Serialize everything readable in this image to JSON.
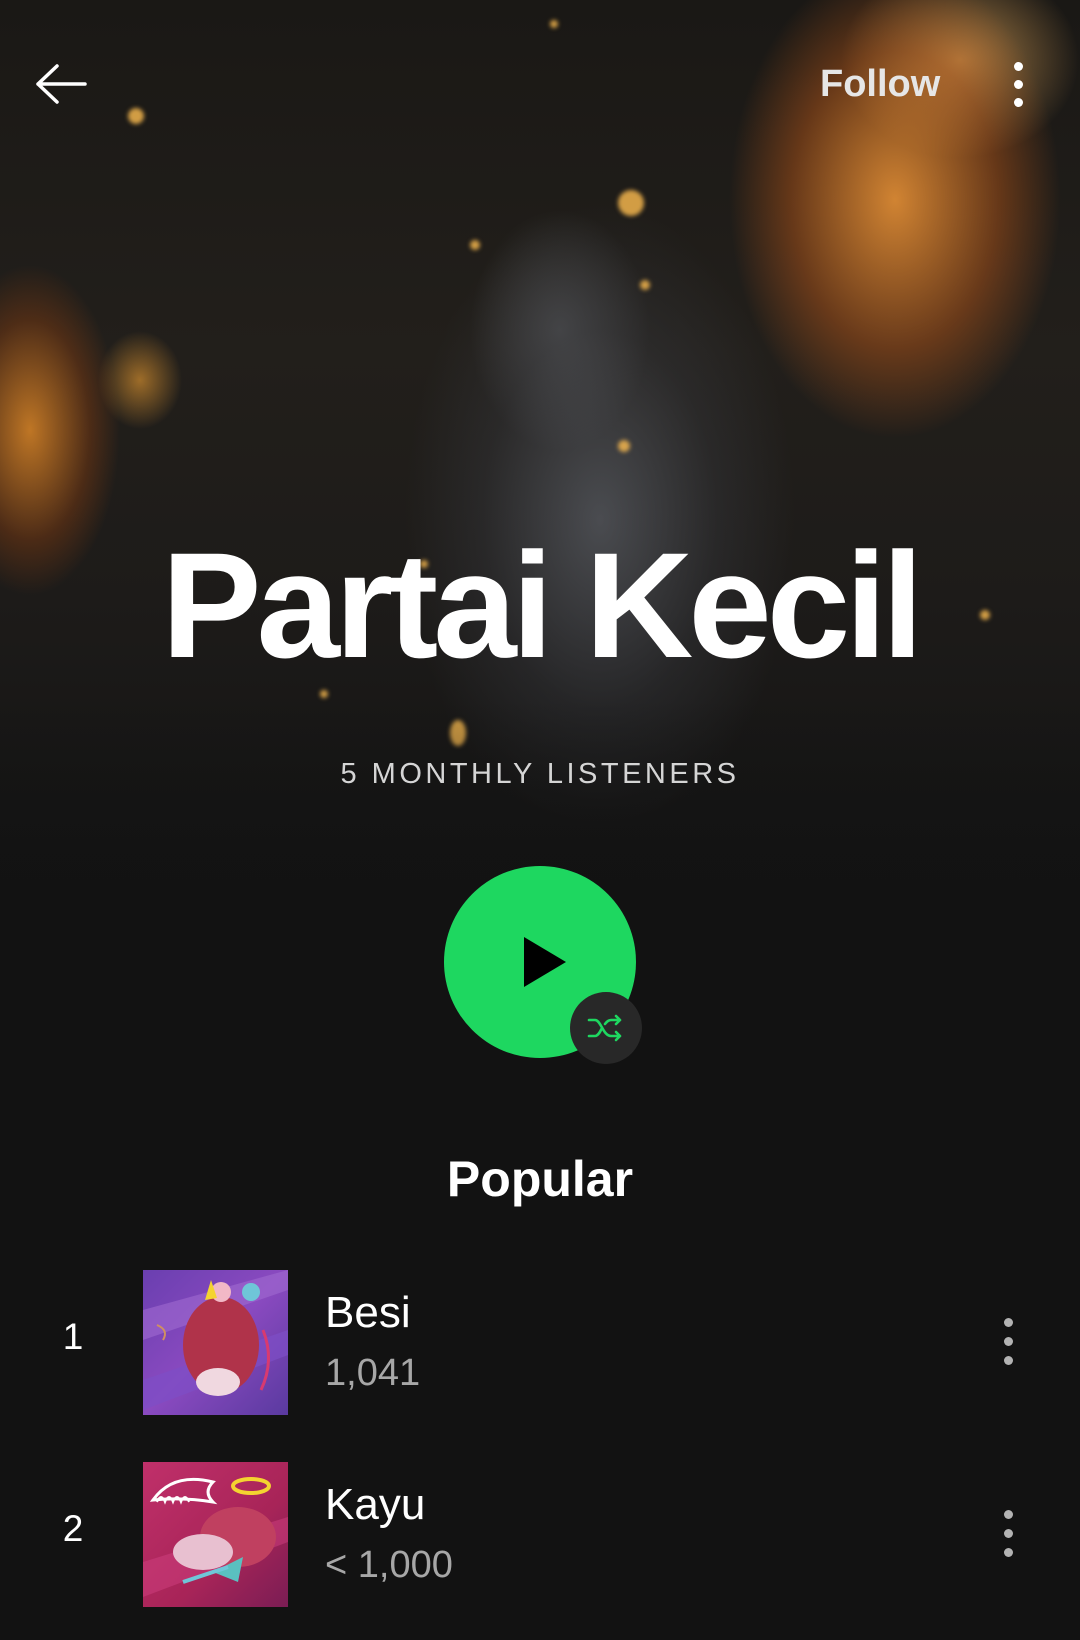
{
  "header": {
    "back_icon": "arrow-left-icon",
    "follow_label": "Follow",
    "more_icon": "more-vertical-icon"
  },
  "artist": {
    "name": "Partai Kecil",
    "monthly_listeners": "5 MONTHLY LISTENERS"
  },
  "controls": {
    "play_icon": "play-icon",
    "shuffle_icon": "shuffle-icon",
    "accent_color": "#1ed760"
  },
  "popular": {
    "title": "Popular",
    "tracks": [
      {
        "rank": "1",
        "title": "Besi",
        "plays": "1,041",
        "artwork": "album-art-purple"
      },
      {
        "rank": "2",
        "title": "Kayu",
        "plays": "< 1,000",
        "artwork": "album-art-magenta"
      }
    ]
  },
  "colors": {
    "background": "#121212",
    "secondary_text": "#a7a7a7",
    "spotify_green": "#1ed760"
  }
}
